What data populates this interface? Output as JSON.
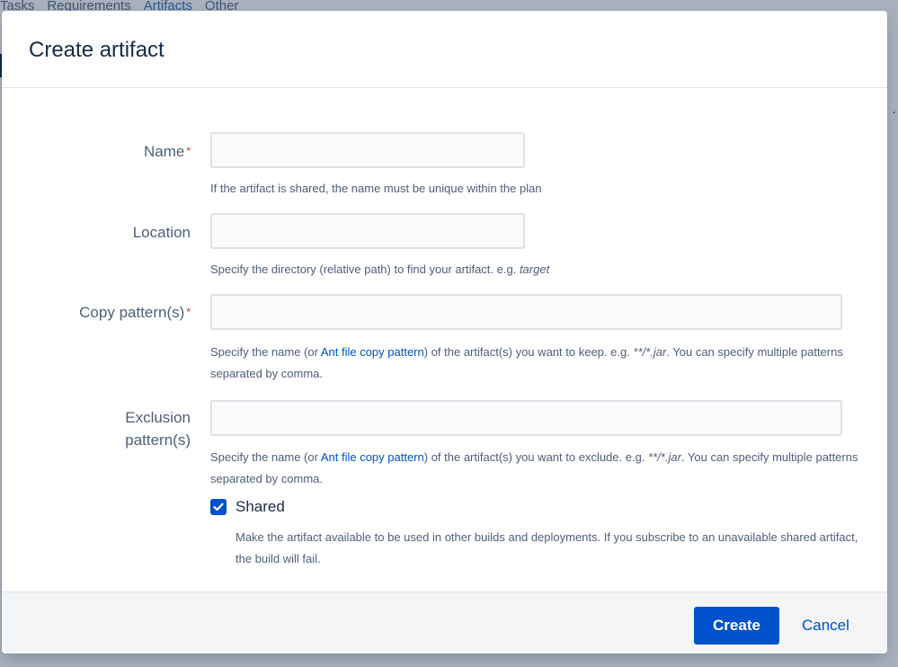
{
  "background": {
    "tabs": [
      "Tasks",
      "Requirements",
      "Artifacts",
      "Other"
    ],
    "active_tab_index": 2,
    "right_text": "."
  },
  "modal": {
    "title": "Create artifact",
    "fields": {
      "name": {
        "label": "Name",
        "required": "*",
        "value": "",
        "help": "If the artifact is shared, the name must be unique within the plan"
      },
      "location": {
        "label": "Location",
        "value": "",
        "help_prefix": "Specify the directory (relative path) to find your artifact. e.g. ",
        "help_example": "target"
      },
      "copy_pattern": {
        "label": "Copy pattern(s)",
        "required": "*",
        "value": "",
        "help_prefix": "Specify the name (or ",
        "help_link": "Ant file copy pattern",
        "help_middle": ") of the artifact(s) you want to keep. e.g. ",
        "help_example": "**/*.jar",
        "help_suffix": ". You can specify multiple patterns separated by comma."
      },
      "exclusion_pattern": {
        "label_line1": "Exclusion",
        "label_line2": "pattern(s)",
        "value": "",
        "help_prefix": "Specify the name (or ",
        "help_link": "Ant file copy pattern",
        "help_middle": ") of the artifact(s) you want to exclude. e.g. ",
        "help_example": "**/*.jar",
        "help_suffix": ". You can specify multiple patterns separated by comma."
      },
      "shared": {
        "label": "Shared",
        "checked": true,
        "help": "Make the artifact available to be used in other builds and deployments. If you subscribe to an unavailable shared artifact, the build will fail."
      }
    },
    "footer": {
      "create_label": "Create",
      "cancel_label": "Cancel"
    }
  },
  "colors": {
    "primary": "#0052cc",
    "required": "#de350b",
    "title": "#172b4d",
    "muted": "#505f79"
  }
}
